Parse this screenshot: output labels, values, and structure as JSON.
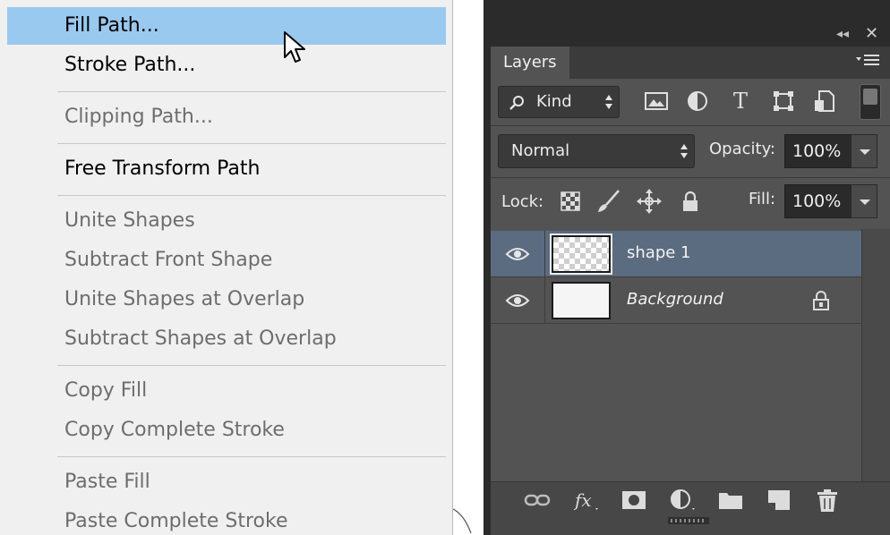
{
  "context_menu": {
    "items": [
      {
        "label": "Fill Path...",
        "state": "highlighted"
      },
      {
        "label": "Stroke Path...",
        "state": "enabled"
      },
      {
        "label": "Clipping Path...",
        "state": "disabled"
      },
      {
        "label": "Free Transform Path",
        "state": "enabled"
      },
      {
        "label": "Unite Shapes",
        "state": "disabled"
      },
      {
        "label": "Subtract Front Shape",
        "state": "disabled"
      },
      {
        "label": "Unite Shapes at Overlap",
        "state": "disabled"
      },
      {
        "label": "Subtract Shapes at Overlap",
        "state": "disabled"
      },
      {
        "label": "Copy Fill",
        "state": "disabled"
      },
      {
        "label": "Copy Complete Stroke",
        "state": "disabled"
      },
      {
        "label": "Paste Fill",
        "state": "disabled"
      },
      {
        "label": "Paste Complete Stroke",
        "state": "disabled"
      }
    ]
  },
  "layers_panel": {
    "tab_label": "Layers",
    "window_controls": {
      "collapse": "◂◂",
      "close": "✕"
    },
    "filter": {
      "kind_label": "Kind",
      "icons": [
        "pixel-filter-icon",
        "adjustment-filter-icon",
        "type-filter-icon",
        "shape-filter-icon",
        "smart-object-filter-icon"
      ]
    },
    "blend_mode": "Normal",
    "opacity_label": "Opacity:",
    "opacity_value": "100%",
    "lock_label": "Lock:",
    "lock_icons": [
      "lock-transparent-pixels-icon",
      "lock-image-pixels-icon",
      "lock-position-icon",
      "lock-all-icon"
    ],
    "fill_label": "Fill:",
    "fill_value": "100%",
    "layers": [
      {
        "name": "shape 1",
        "selected": true,
        "locked": false,
        "italic": false
      },
      {
        "name": "Background",
        "selected": false,
        "locked": true,
        "italic": true
      }
    ],
    "bottom_icons": [
      "link-layers-icon",
      "fx-icon",
      "add-mask-icon",
      "adjustment-layer-icon",
      "new-group-icon",
      "new-layer-icon",
      "delete-layer-icon"
    ]
  },
  "colors": {
    "menu_bg": "#f0f0f0",
    "menu_highlight": "#99c9ef",
    "panel_bg": "#535353",
    "selected_layer": "#5b6b80"
  }
}
